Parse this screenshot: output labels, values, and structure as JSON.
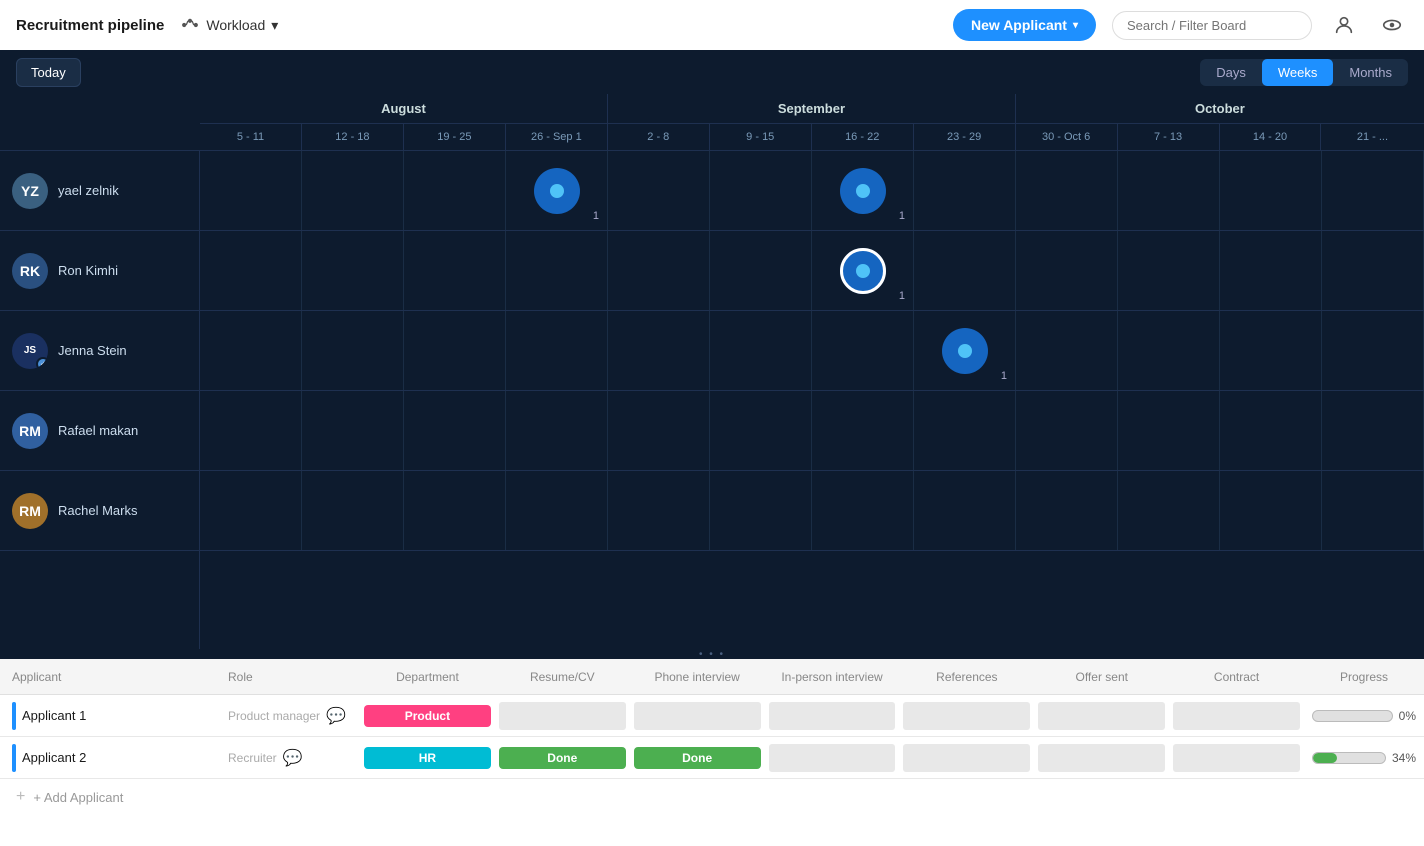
{
  "nav": {
    "title": "Recruitment pipeline",
    "workload_label": "Workload",
    "new_applicant_label": "New Applicant",
    "search_placeholder": "Search / Filter Board"
  },
  "toolbar": {
    "today_label": "Today",
    "view_days": "Days",
    "view_weeks": "Weeks",
    "view_months": "Months"
  },
  "timeline": {
    "months": [
      {
        "label": "August",
        "span": 4
      },
      {
        "label": "September",
        "span": 4
      },
      {
        "label": "October",
        "span": 4
      }
    ],
    "weeks": [
      "5 - 11",
      "12 - 18",
      "19 - 25",
      "26 - Sep 1",
      "2 - 8",
      "9 - 15",
      "16 - 22",
      "23 - 29",
      "30 - Oct 6",
      "7 - 13",
      "14 - 20",
      "21 - ..."
    ]
  },
  "people": [
    {
      "name": "yael zelnik",
      "initials": "YZ",
      "color": "#3a6ea5",
      "events": [
        {
          "week_index": 3,
          "count": 1
        },
        {
          "week_index": 6,
          "count": 1
        }
      ]
    },
    {
      "name": "Ron Kimhi",
      "initials": "RK",
      "color": "#2a5080",
      "events": [
        {
          "week_index": 6,
          "count": 1,
          "ring": true
        }
      ]
    },
    {
      "name": "Jenna Stein",
      "initials": "JS",
      "color": "#1a3060",
      "events": [
        {
          "week_index": 7,
          "count": 1
        }
      ]
    },
    {
      "name": "Rafael makan",
      "initials": "RM",
      "color": "#3060a0",
      "events": []
    },
    {
      "name": "Rachel Marks",
      "initials": "RM2",
      "color": "#a0702a",
      "events": []
    }
  ],
  "table": {
    "headers": {
      "applicant": "Applicant",
      "role": "Role",
      "department": "Department",
      "resume": "Resume/CV",
      "phone": "Phone interview",
      "in_person": "In-person interview",
      "references": "References",
      "offer": "Offer sent",
      "contract": "Contract",
      "progress": "Progress"
    },
    "rows": [
      {
        "name": "Applicant 1",
        "role": "Product manager",
        "department": "Product",
        "dept_class": "badge-product",
        "resume": "",
        "phone": "",
        "in_person": "",
        "references": "",
        "offer": "",
        "contract": "",
        "progress_pct": 0,
        "progress_label": "0%",
        "indicator_color": "#1e90ff"
      },
      {
        "name": "Applicant 2",
        "role": "Recruiter",
        "department": "HR",
        "dept_class": "badge-hr",
        "resume": "Done",
        "phone": "Done",
        "in_person": "",
        "references": "",
        "offer": "",
        "contract": "",
        "progress_pct": 34,
        "progress_label": "34%",
        "indicator_color": "#1e90ff"
      }
    ],
    "add_label": "+ Add Applicant"
  }
}
